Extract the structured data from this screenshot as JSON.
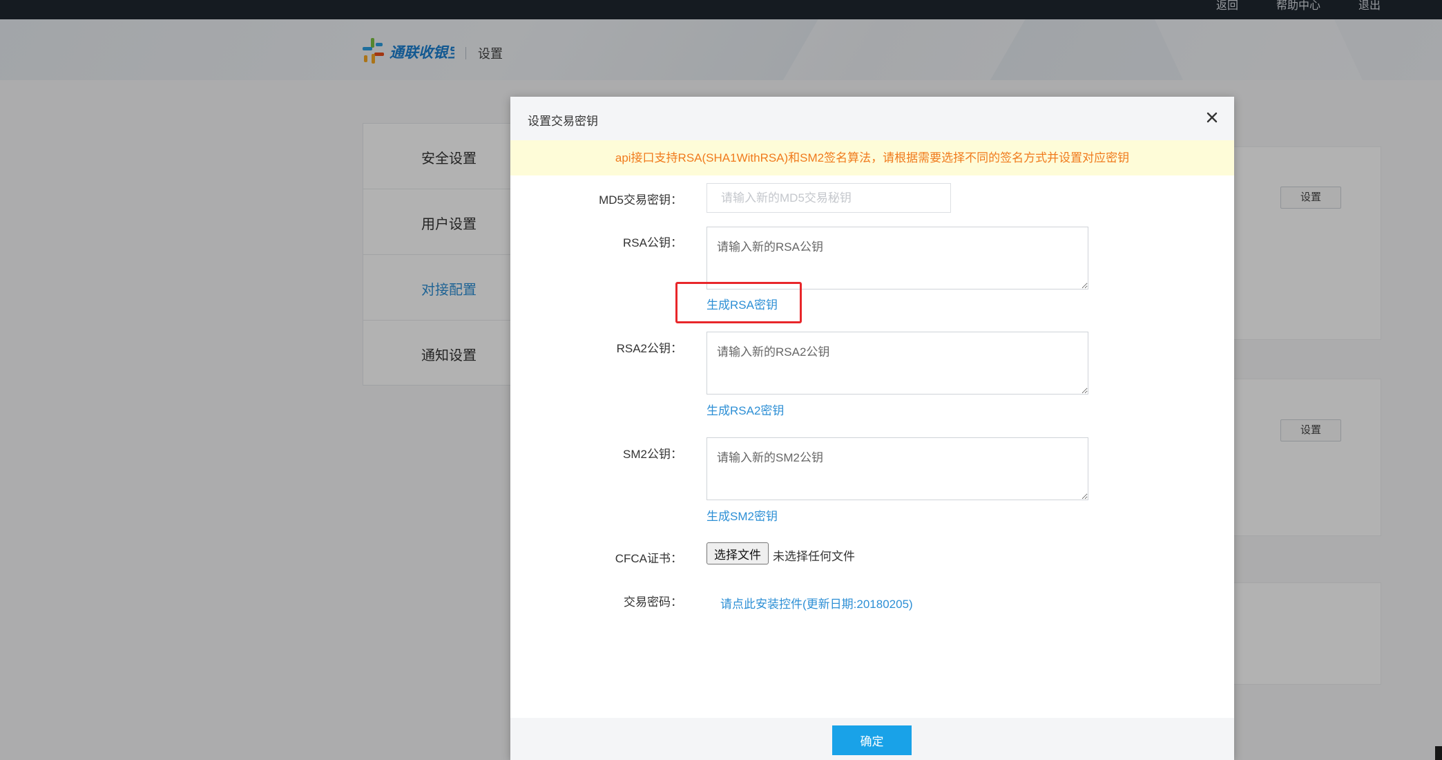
{
  "topbar": {
    "links": [
      "返回",
      "帮助中心",
      "退出"
    ]
  },
  "header": {
    "logo_text": "通联收银宝",
    "title": "设置",
    "logo_colors": [
      "#f5a623",
      "#2d9ee0",
      "#7ac143",
      "#e94e1b"
    ]
  },
  "sidebar": {
    "items": [
      {
        "label": "安全设置",
        "active": false
      },
      {
        "label": "用户设置",
        "active": false
      },
      {
        "label": "对接配置",
        "active": true
      },
      {
        "label": "通知设置",
        "active": false
      }
    ]
  },
  "background_buttons": [
    "设置",
    "设置"
  ],
  "modal": {
    "title": "设置交易密钥",
    "close_icon": "close-icon",
    "notice": "api接口支持RSA(SHA1WithRSA)和SM2签名算法，请根据需要选择不同的签名方式并设置对应密钥",
    "md5": {
      "label": "MD5交易密钥：",
      "placeholder": "请输入新的MD5交易秘钥",
      "value": ""
    },
    "rsa": {
      "label": "RSA公钥：",
      "placeholder": "请输入新的RSA公钥",
      "value": "",
      "generate_link": "生成RSA密钥"
    },
    "rsa2": {
      "label": "RSA2公钥：",
      "placeholder": "请输入新的RSA2公钥",
      "value": "",
      "generate_link": "生成RSA2密钥"
    },
    "sm2": {
      "label": "SM2公钥：",
      "placeholder": "请输入新的SM2公钥",
      "value": "",
      "generate_link": "生成SM2密钥"
    },
    "cfca": {
      "label": "CFCA证书：",
      "button": "选择文件",
      "status": "未选择任何文件"
    },
    "trade_password": {
      "label": "交易密码：",
      "link": "请点此安装控件(更新日期:20180205)"
    },
    "confirm": "确定"
  },
  "colors": {
    "accent_link": "#2d8fd5",
    "confirm_button": "#19a2e8",
    "notice_text": "#f07a1c",
    "notice_bg": "#fefcd8",
    "highlight_border": "#e8262a"
  }
}
